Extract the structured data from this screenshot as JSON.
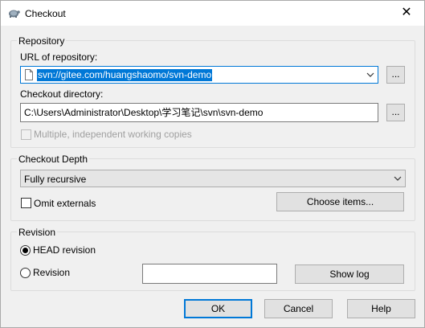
{
  "window": {
    "title": "Checkout",
    "close_glyph": "✕"
  },
  "repository": {
    "legend": "Repository",
    "url_label": "URL of repository:",
    "url_value": "svn://gitee.com/huangshaomo/svn-demo",
    "url_browse": "...",
    "dir_label": "Checkout directory:",
    "dir_value": "C:\\Users\\Administrator\\Desktop\\学习笔记\\svn\\svn-demo",
    "dir_browse": "...",
    "multiple_copies_label": "Multiple, independent working copies",
    "multiple_copies_checked": false
  },
  "depth": {
    "legend": "Checkout Depth",
    "selected": "Fully recursive",
    "omit_externals_label": "Omit externals",
    "omit_externals_checked": false,
    "choose_items_label": "Choose items..."
  },
  "revision": {
    "legend": "Revision",
    "head_label": "HEAD revision",
    "head_selected": true,
    "revision_label": "Revision",
    "revision_value": "",
    "show_log_label": "Show log"
  },
  "buttons": {
    "ok": "OK",
    "cancel": "Cancel",
    "help": "Help"
  },
  "colors": {
    "accent": "#0078d7",
    "dialog_bg": "#f0f0f0"
  }
}
